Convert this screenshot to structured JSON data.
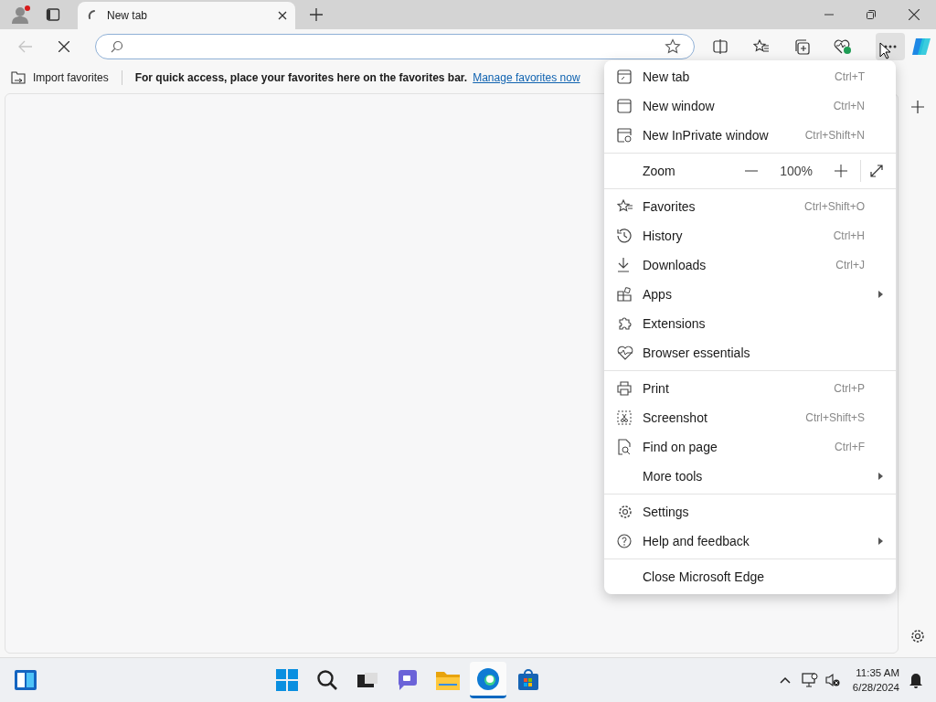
{
  "tab": {
    "title": "New tab",
    "loading": true
  },
  "favorites_bar": {
    "import": "Import favorites",
    "message": "For quick access, place your favorites here on the favorites bar.",
    "link": "Manage favorites now"
  },
  "menu": {
    "groups": [
      [
        {
          "kind": "item",
          "label": "New tab",
          "shortcut": "Ctrl+T",
          "submenu": false
        },
        {
          "kind": "item",
          "label": "New window",
          "shortcut": "Ctrl+N",
          "submenu": false
        },
        {
          "kind": "item",
          "label": "New InPrivate window",
          "shortcut": "Ctrl+Shift+N",
          "submenu": false
        }
      ],
      [
        {
          "kind": "zoom",
          "label": "Zoom",
          "value": "100%"
        }
      ],
      [
        {
          "kind": "item",
          "label": "Favorites",
          "shortcut": "Ctrl+Shift+O",
          "submenu": false
        },
        {
          "kind": "item",
          "label": "History",
          "shortcut": "Ctrl+H",
          "submenu": false
        },
        {
          "kind": "item",
          "label": "Downloads",
          "shortcut": "Ctrl+J",
          "submenu": false
        },
        {
          "kind": "item",
          "label": "Apps",
          "submenu": true
        },
        {
          "kind": "item",
          "label": "Extensions",
          "submenu": false
        },
        {
          "kind": "item",
          "label": "Browser essentials",
          "submenu": false
        }
      ],
      [
        {
          "kind": "item",
          "label": "Print",
          "shortcut": "Ctrl+P",
          "submenu": false
        },
        {
          "kind": "item",
          "label": "Screenshot",
          "shortcut": "Ctrl+Shift+S",
          "submenu": false
        },
        {
          "kind": "item",
          "label": "Find on page",
          "shortcut": "Ctrl+F",
          "submenu": false
        },
        {
          "kind": "item",
          "label": "More tools",
          "submenu": true
        }
      ],
      [
        {
          "kind": "item",
          "label": "Settings",
          "submenu": false
        },
        {
          "kind": "item",
          "label": "Help and feedback",
          "submenu": true
        }
      ],
      [
        {
          "kind": "item",
          "label": "Close Microsoft Edge",
          "submenu": false
        }
      ]
    ]
  },
  "taskbar": {
    "apps": [
      {
        "kind": "start",
        "selected": false
      },
      {
        "kind": "search",
        "selected": false
      },
      {
        "kind": "taskview",
        "selected": false
      },
      {
        "kind": "chat",
        "selected": false
      },
      {
        "kind": "explorer",
        "selected": false
      },
      {
        "kind": "edge",
        "selected": true
      },
      {
        "kind": "store",
        "selected": false
      }
    ],
    "time": "11:35 AM",
    "date": "6/28/2024"
  }
}
